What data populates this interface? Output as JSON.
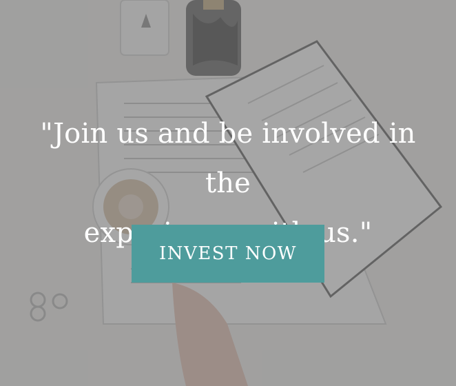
{
  "hero": {
    "quote_line_1": "\"Join us and be involved in the",
    "quote_line_2": "experience with us.\"",
    "cta_label": "INVEST NOW"
  },
  "colors": {
    "overlay": "#5c5c5c",
    "button_background": "#4e9c9c",
    "text": "#ffffff"
  },
  "background": {
    "description_icons": [
      "perfume-bottle-icon",
      "vase-icon",
      "open-book-icon",
      "notebook-icon",
      "coffee-cup-icon",
      "rings-icon",
      "hand-icon"
    ]
  }
}
